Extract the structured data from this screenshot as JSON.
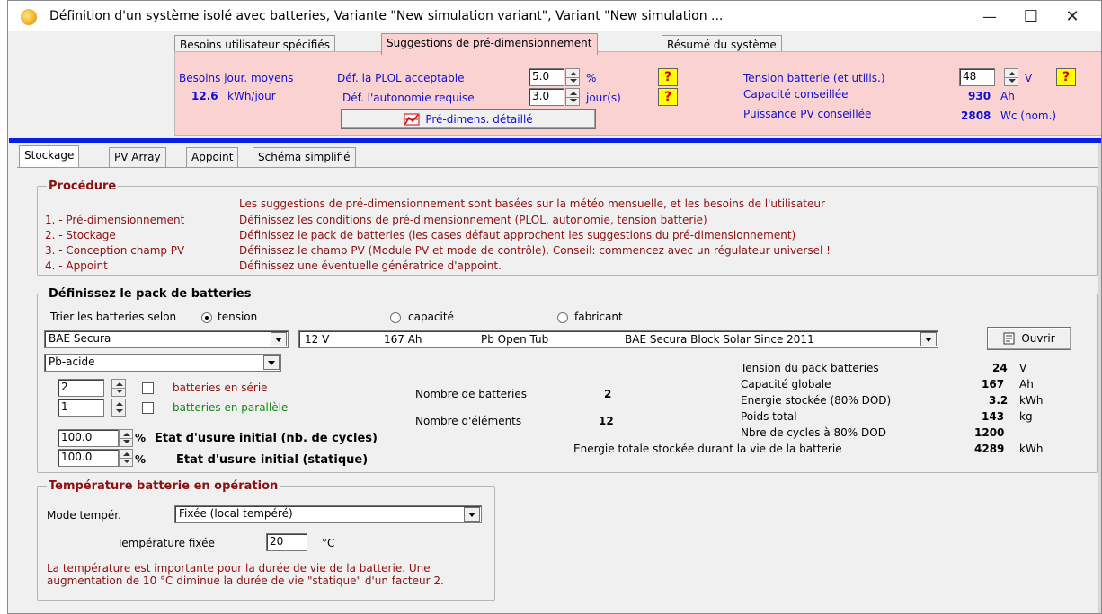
{
  "window": {
    "title": "Définition d'un système isolé avec batteries, Variante  \"New simulation variant\", Variant  \"New simulation ...",
    "minimize": "—",
    "maximize": "☐",
    "close": "✕"
  },
  "top_tabs": [
    "Besoins utilisateur spécifiés",
    "Suggestions de pré-dimensionnement",
    "Résumé du système"
  ],
  "presizing": {
    "besoins_label": "Besoins jour. moyens",
    "besoins_value": "12.6",
    "besoins_unit": "kWh/jour",
    "plol_label": "Déf. la PLOL  acceptable",
    "plol_value": "5.0",
    "plol_unit": "%",
    "autonomie_label": "Déf. l'autonomie requise",
    "autonomie_value": "3.0",
    "autonomie_unit": "jour(s)",
    "help": "?",
    "detail_button": "Pré-dimens. détaillé",
    "tension_label": "Tension batterie (et utilis.)",
    "tension_value": "48",
    "tension_unit": "V",
    "capacite_label": "Capacité conseillée",
    "capacite_value": "930",
    "capacite_unit": "Ah",
    "puissance_label": "Puissance PV conseillée",
    "puissance_value": "2808",
    "puissance_unit": "Wc (nom.)"
  },
  "sub_tabs": [
    "Stockage",
    "PV Array",
    "Appoint",
    "Schéma simplifié"
  ],
  "procedure": {
    "title": "Procédure",
    "intro": "Les suggestions de pré-dimensionnement sont basées sur la météo mensuelle, et les besoins de l'utilisateur",
    "steps": [
      {
        "label": "1. - Pré-dimensionnement",
        "text": "Définissez les conditions de pré-dimensionnement  (PLOL, autonomie, tension batterie)"
      },
      {
        "label": "2. - Stockage",
        "text": "Définissez le pack de batteries   (les cases défaut approchent les suggestions du  pré-dimensionnement)"
      },
      {
        "label": "3. - Conception champ PV",
        "text": "Définissez le champ PV  (Module PV et mode de contrôle).  Conseil: commencez avec un régulateur universel !"
      },
      {
        "label": "4. - Appoint",
        "text": "Définissez une éventuelle génératrice d'appoint."
      }
    ]
  },
  "battery_pack": {
    "title": "Définissez le pack de batteries",
    "sort_label": "Trier les batteries selon",
    "sort_options": [
      "tension",
      "capacité",
      "fabricant"
    ],
    "manufacturer": "BAE Secura",
    "battery_desc": {
      "voltage": "12 V",
      "capacity": "167 Ah",
      "tech": "Pb  Open  Tub",
      "model": "BAE Secura Block Solar  Since 2011"
    },
    "open_button": "Ouvrir",
    "type": "Pb-acide",
    "serie_value": "2",
    "serie_label": "batteries en série",
    "parallel_value": "1",
    "parallel_label": "batteries en parallèle",
    "nb_batteries_label": "Nombre de batteries",
    "nb_batteries_value": "2",
    "nb_elements_label": "Nombre d'éléments",
    "nb_elements_value": "12",
    "usure_cycles_value": "100.0",
    "usure_cycles_label": "Etat d'usure initial (nb. de cycles)",
    "usure_static_value": "100.0",
    "usure_static_label": "Etat d'usure initial (statique)",
    "pct": "%",
    "stats": [
      {
        "label": "Tension du pack batteries",
        "value": "24",
        "unit": "V"
      },
      {
        "label": "Capacité globale",
        "value": "167",
        "unit": "Ah"
      },
      {
        "label": "Energie stockée (80% DOD)",
        "value": "3.2",
        "unit": "kWh"
      },
      {
        "label": "Poids total",
        "value": "143",
        "unit": "kg"
      },
      {
        "label": "Nbre de cycles à 80% DOD",
        "value": "1200",
        "unit": ""
      }
    ],
    "lifetime_label": "Energie totale stockée durant la vie de la batterie",
    "lifetime_value": "4289",
    "lifetime_unit": "kWh"
  },
  "temperature": {
    "title": "Température batterie en opération",
    "mode_label": "Mode tempér.",
    "mode_value": "Fixée (local tempéré)",
    "fixed_label": "Température fixée",
    "fixed_value": "20",
    "fixed_unit": "°C",
    "note": "La température est importante pour la durée de vie de la batterie. Une augmentation de 10 °C diminue la durée de vie \"statique\" d'un facteur 2."
  }
}
